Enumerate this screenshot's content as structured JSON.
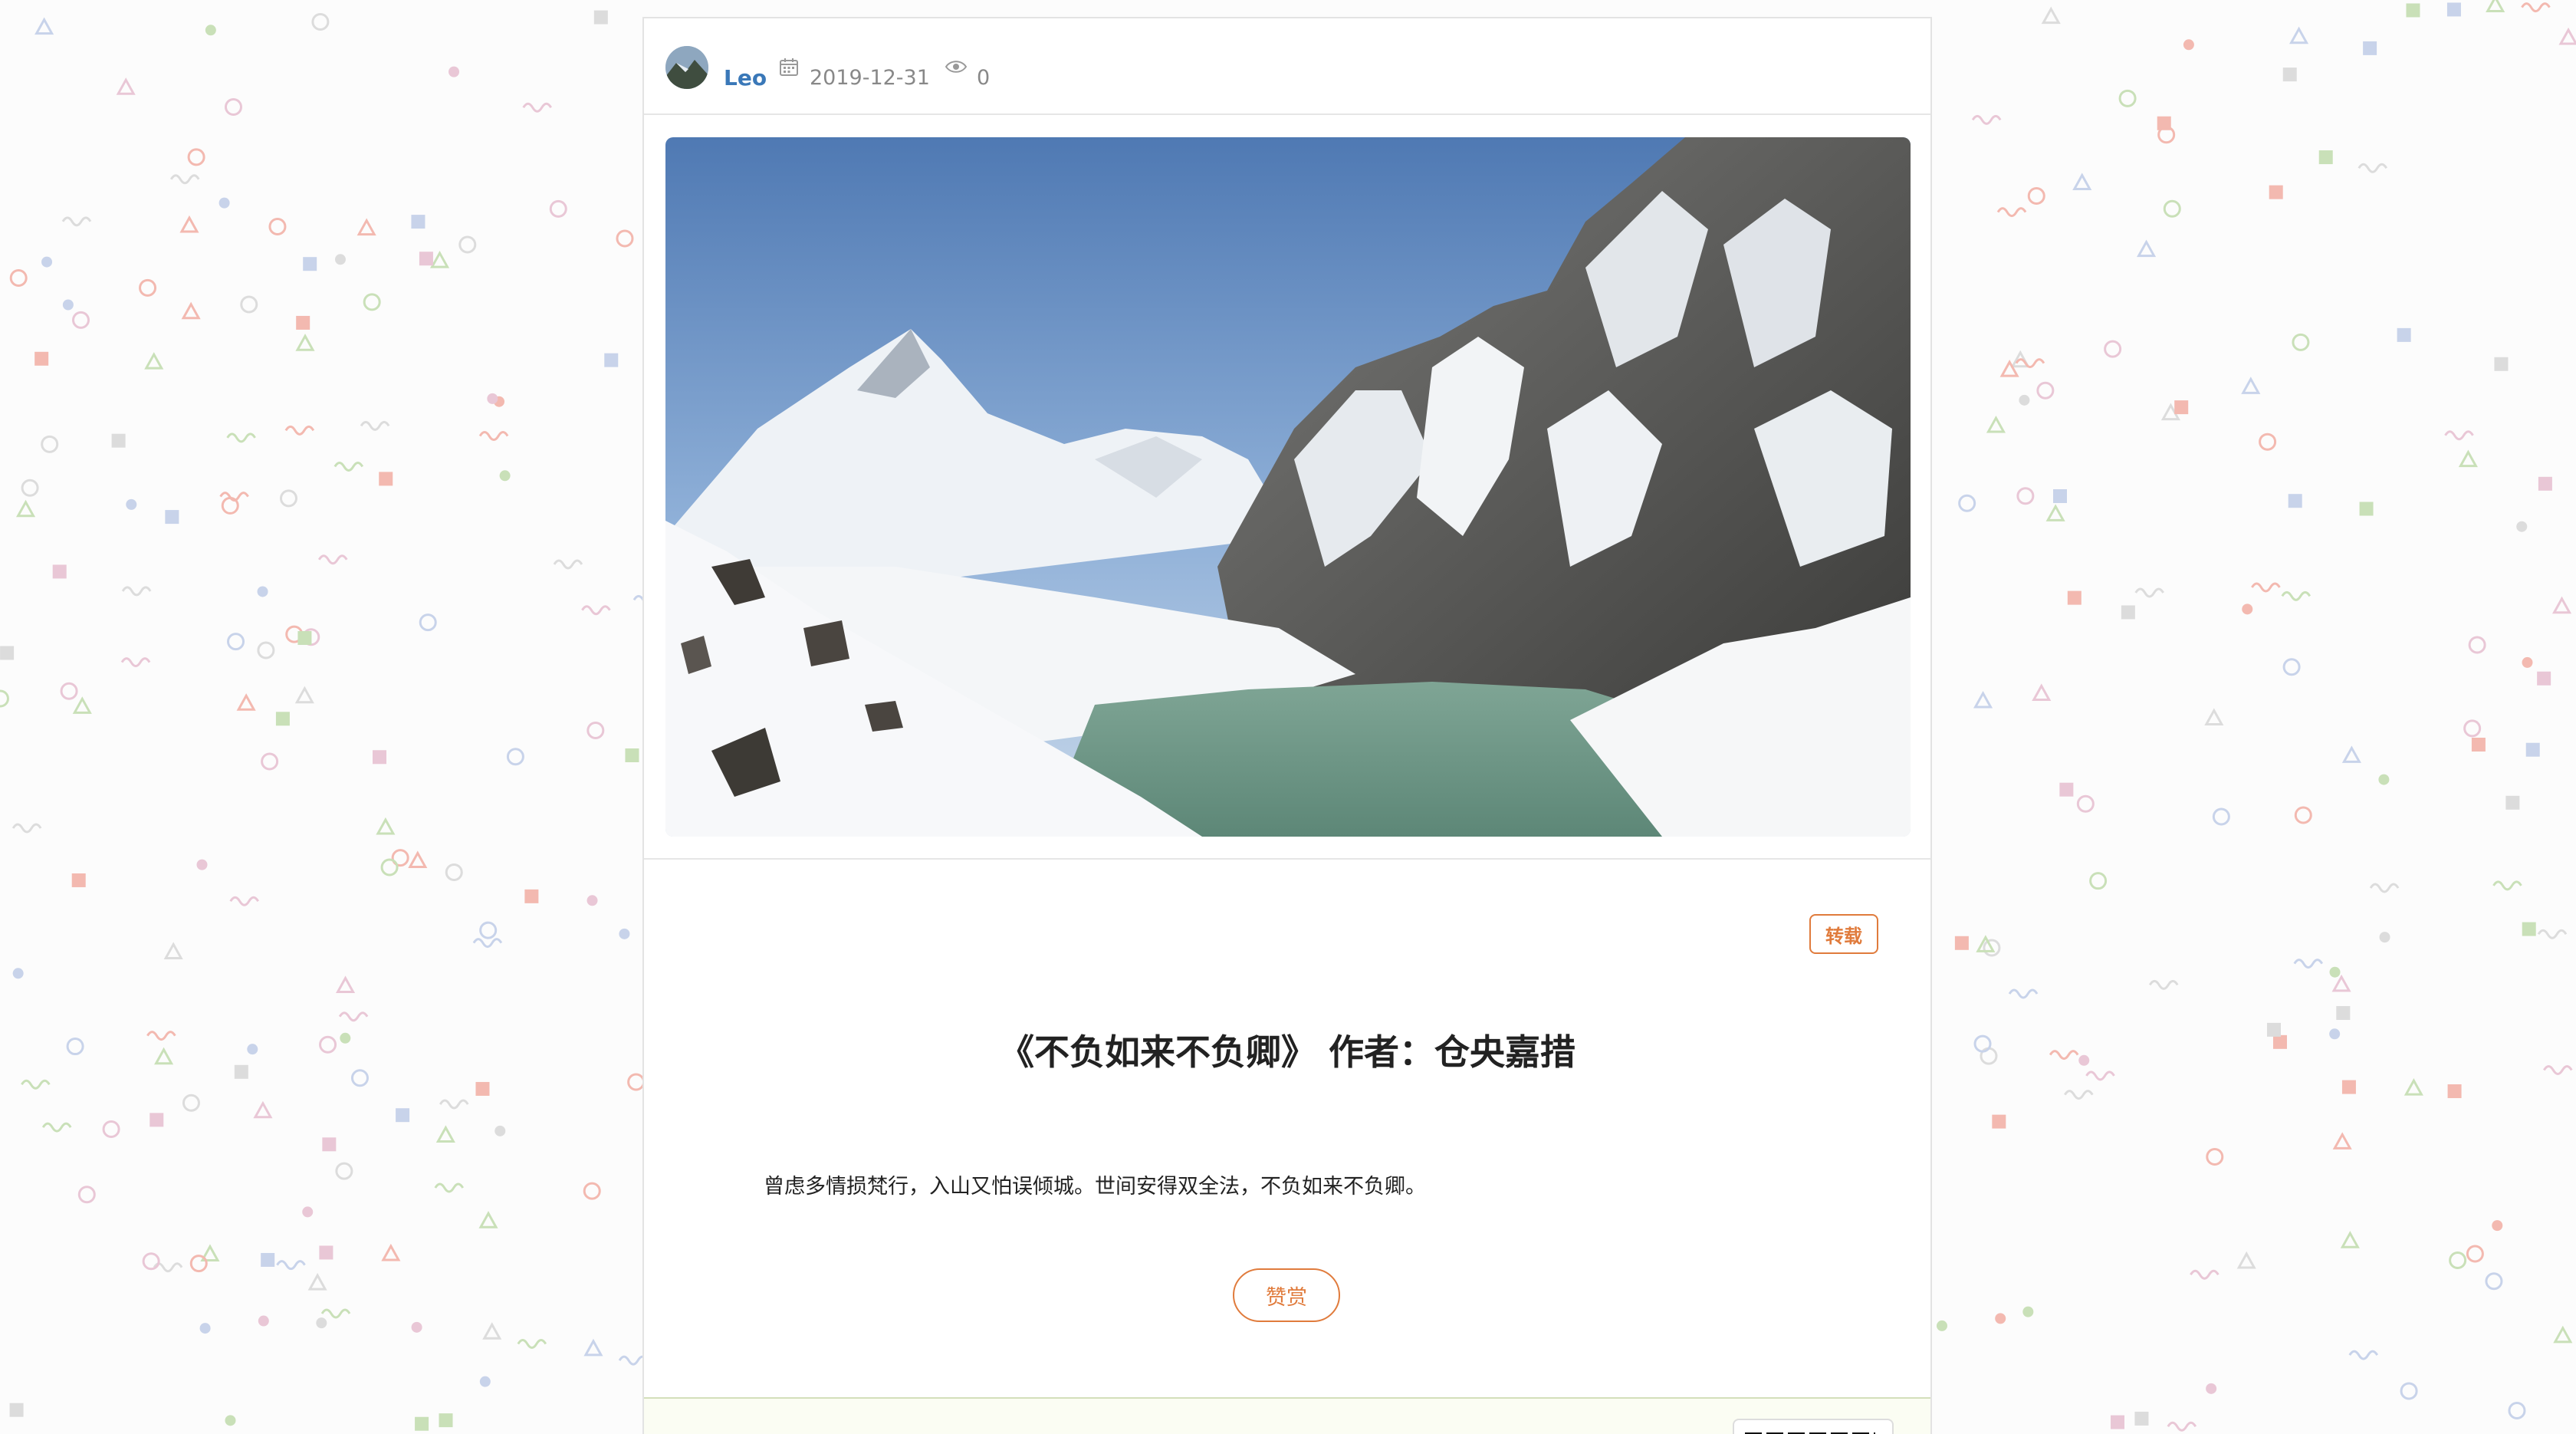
{
  "post": {
    "author": "Leo",
    "date": "2019-12-31",
    "views": "0",
    "badge": "转载",
    "title": "《不负如来不负卿》 作者：仓央嘉措",
    "body": "曾虑多情损梵行，入山又怕误倾城。世间安得双全法，不负如来不负卿。",
    "reward_button": "赞赏"
  },
  "icons": {
    "calendar": "calendar-icon",
    "views": "eye-icon"
  },
  "colors": {
    "author": "#3a78b8",
    "accent": "#e07b3c",
    "muted": "#888888"
  }
}
